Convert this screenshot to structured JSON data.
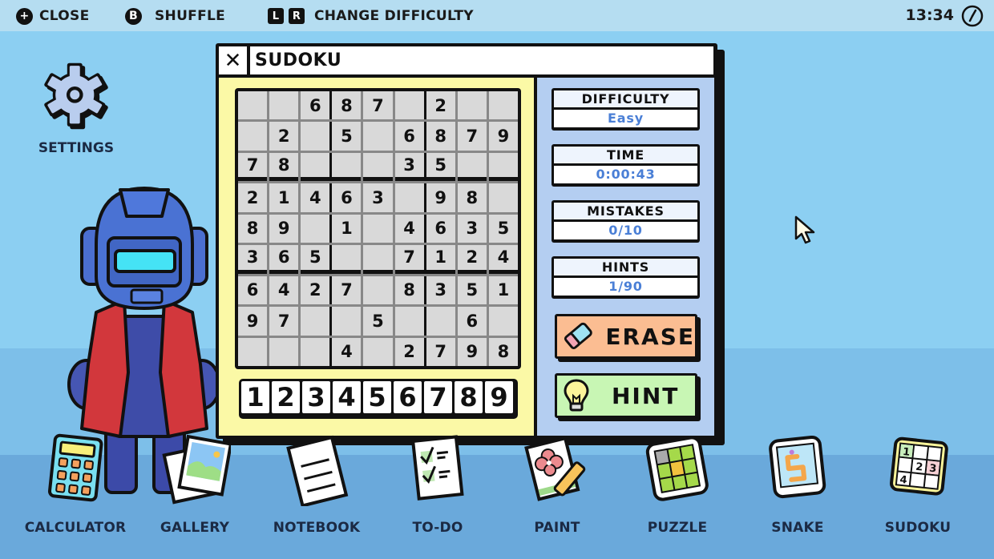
{
  "topbar": {
    "hints": [
      {
        "button": "+",
        "label": "CLOSE"
      },
      {
        "button": "B",
        "label": "SHUFFLE"
      },
      {
        "buttons": [
          "L",
          "R"
        ],
        "label": "CHANGE DIFFICULTY"
      }
    ],
    "time": "13:34",
    "clock_icon": "clock-icon"
  },
  "settings": {
    "label": "SETTINGS",
    "icon": "gear-icon"
  },
  "window": {
    "title": "SUDOKU",
    "close_icon": "close-icon",
    "board": [
      [
        "",
        "",
        "6",
        "8",
        "7",
        "",
        "2",
        "",
        ""
      ],
      [
        "",
        "2",
        "",
        "5",
        "",
        "6",
        "8",
        "7",
        "9"
      ],
      [
        "7",
        "8",
        "",
        "",
        "",
        "3",
        "5",
        "",
        ""
      ],
      [
        "2",
        "1",
        "4",
        "6",
        "3",
        "",
        "9",
        "8",
        ""
      ],
      [
        "8",
        "9",
        "",
        "1",
        "",
        "4",
        "6",
        "3",
        "5"
      ],
      [
        "3",
        "6",
        "5",
        "",
        "",
        "7",
        "1",
        "2",
        "4"
      ],
      [
        "6",
        "4",
        "2",
        "7",
        "",
        "8",
        "3",
        "5",
        "1"
      ],
      [
        "9",
        "7",
        "",
        "",
        "5",
        "",
        "",
        "6",
        ""
      ],
      [
        "",
        "",
        "",
        "4",
        "",
        "2",
        "7",
        "9",
        "8"
      ]
    ],
    "numpad": [
      "1",
      "2",
      "3",
      "4",
      "5",
      "6",
      "7",
      "8",
      "9"
    ],
    "stats": {
      "difficulty": {
        "label": "DIFFICULTY",
        "value": "Easy"
      },
      "time": {
        "label": "TIME",
        "value": "0:00:43"
      },
      "mistakes": {
        "label": "MISTAKES",
        "value": "0/10"
      },
      "hints": {
        "label": "HINTS",
        "value": "1/90"
      }
    },
    "erase_label": "ERASE",
    "hint_label": "HINT"
  },
  "dock": [
    {
      "label": "CALCULATOR",
      "icon": "calculator-icon"
    },
    {
      "label": "GALLERY",
      "icon": "gallery-icon"
    },
    {
      "label": "NOTEBOOK",
      "icon": "notebook-icon"
    },
    {
      "label": "TO-DO",
      "icon": "todo-icon"
    },
    {
      "label": "PAINT",
      "icon": "paint-icon"
    },
    {
      "label": "PUZZLE",
      "icon": "puzzle-icon"
    },
    {
      "label": "SNAKE",
      "icon": "snake-icon"
    },
    {
      "label": "SUDOKU",
      "icon": "sudoku-icon"
    }
  ],
  "colors": {
    "stat_value": "#4a7fd6",
    "board_pane": "#fbf9a6",
    "side_pane": "#b4cef1",
    "erase": "#fbbd92",
    "hint": "#c8f6b4"
  }
}
